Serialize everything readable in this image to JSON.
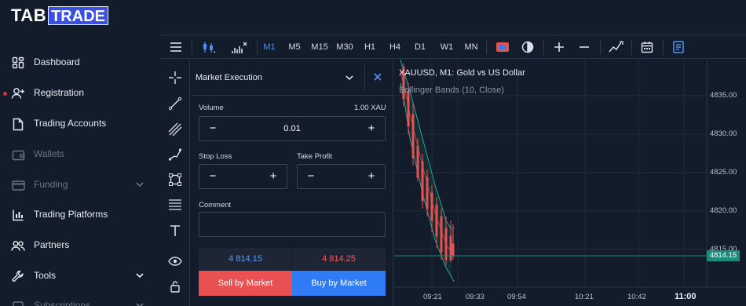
{
  "logo": {
    "part1": "TAB",
    "part2": "TRADE"
  },
  "sidebar": {
    "items": [
      {
        "label": "Dashboard",
        "icon": "dashboard-icon"
      },
      {
        "label": "Registration",
        "icon": "user-add-icon"
      },
      {
        "label": "Trading Accounts",
        "icon": "document-icon"
      },
      {
        "label": "Wallets",
        "icon": "wallet-icon"
      },
      {
        "label": "Funding",
        "icon": "card-icon"
      },
      {
        "label": "Trading Platforms",
        "icon": "bar-chart-icon"
      },
      {
        "label": "Partners",
        "icon": "users-icon"
      },
      {
        "label": "Tools",
        "icon": "wrench-icon"
      },
      {
        "label": "Subscriptions",
        "icon": "subscriptions-icon"
      }
    ]
  },
  "toolbar": {
    "timeframes": [
      "M1",
      "M5",
      "M15",
      "M30",
      "H1",
      "H4",
      "D1",
      "W1",
      "MN"
    ],
    "active_timeframe": "M1"
  },
  "order_panel": {
    "title": "Market Execution",
    "volume_label": "Volume",
    "volume_unit": "1.00 XAU",
    "volume_value": "0.01",
    "stop_loss_label": "Stop Loss",
    "take_profit_label": "Take Profit",
    "comment_label": "Comment",
    "bid_price": "4 814.15",
    "ask_price": "4 814.25",
    "sell_label": "Sell by Market",
    "buy_label": "Buy by Market"
  },
  "chart": {
    "title": "XAUUSD, M1: Gold vs US Dollar",
    "indicator": "Bollinger Bands (10, Close)",
    "y_ticks": [
      "4835.00",
      "4830.00",
      "4825.00",
      "4820.00",
      "4815.00"
    ],
    "x_ticks": [
      "09:21",
      "09:33",
      "09:54",
      "10:21",
      "10:42",
      "11:00"
    ],
    "current_price": "4814.15"
  },
  "colors": {
    "accent": "#4d8ef7",
    "sell": "#e85052",
    "buy": "#2f7cf6",
    "bid_text": "#5b9cf7",
    "ask_text": "#f05a5a",
    "price_line": "#1f8b7a"
  }
}
